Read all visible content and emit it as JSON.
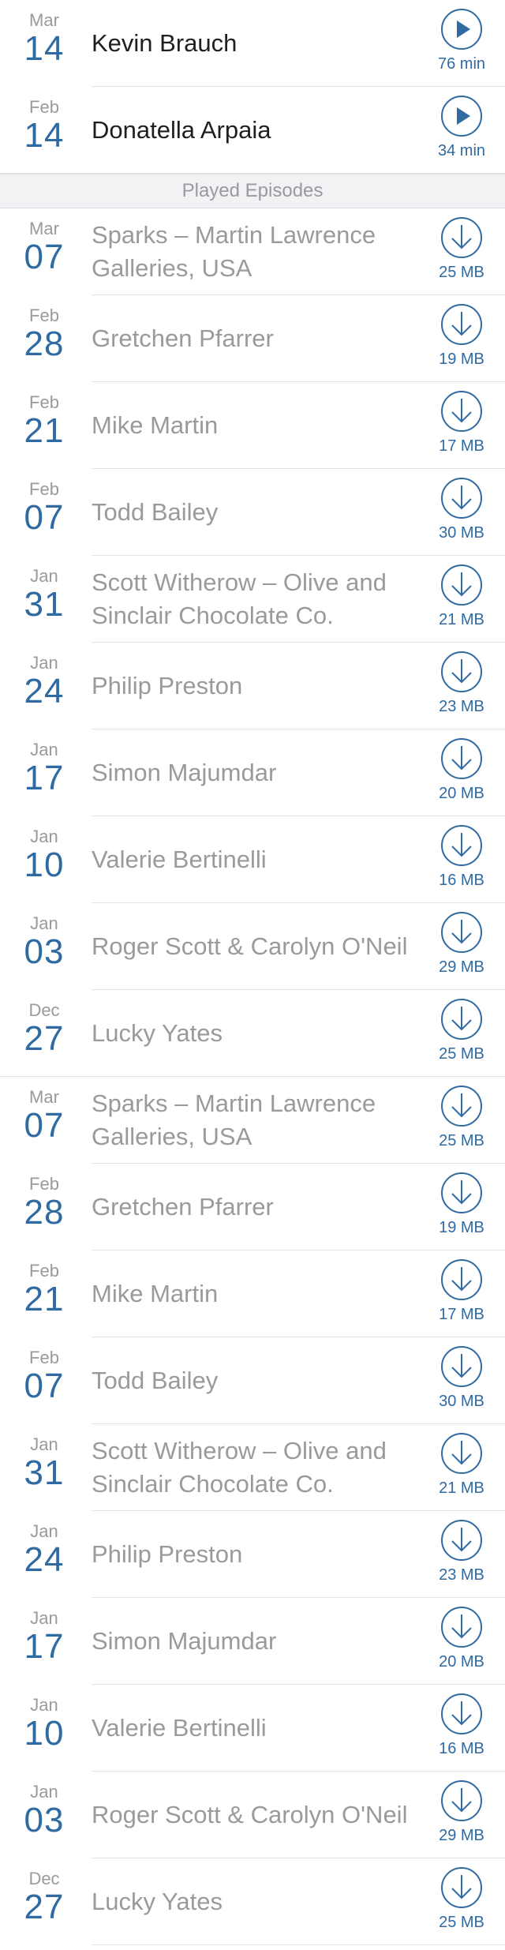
{
  "colors": {
    "accent": "#2f6aa3",
    "muted": "#9a9a9e",
    "separator": "#e3e3e6",
    "header_bg": "#f2f2f4"
  },
  "unplayed": [
    {
      "month": "Mar",
      "day": "14",
      "title": "Kevin Brauch",
      "action": "play-icon",
      "meta": "76 min"
    },
    {
      "month": "Feb",
      "day": "14",
      "title": "Donatella Arpaia",
      "action": "play-icon",
      "meta": "34 min"
    }
  ],
  "played_header": "Played Episodes",
  "played": [
    {
      "month": "Mar",
      "day": "07",
      "title": "Sparks – Martin Lawrence Galleries, USA",
      "action": "download-icon",
      "meta": "25 MB"
    },
    {
      "month": "Feb",
      "day": "28",
      "title": "Gretchen Pfarrer",
      "action": "download-icon",
      "meta": "19 MB"
    },
    {
      "month": "Feb",
      "day": "21",
      "title": "Mike Martin",
      "action": "download-icon",
      "meta": "17 MB"
    },
    {
      "month": "Feb",
      "day": "07",
      "title": "Todd Bailey",
      "action": "download-icon",
      "meta": "30 MB"
    },
    {
      "month": "Jan",
      "day": "31",
      "title": "Scott Witherow – Olive and Sinclair Chocolate Co.",
      "action": "download-icon",
      "meta": "21 MB"
    },
    {
      "month": "Jan",
      "day": "24",
      "title": "Philip Preston",
      "action": "download-icon",
      "meta": "23 MB"
    },
    {
      "month": "Jan",
      "day": "17",
      "title": "Simon Majumdar",
      "action": "download-icon",
      "meta": "20 MB"
    },
    {
      "month": "Jan",
      "day": "10",
      "title": "Valerie Bertinelli",
      "action": "download-icon",
      "meta": "16 MB"
    },
    {
      "month": "Jan",
      "day": "03",
      "title": "Roger Scott & Carolyn O'Neil",
      "action": "download-icon",
      "meta": "29 MB"
    },
    {
      "month": "Dec",
      "day": "27",
      "title": "Lucky Yates",
      "action": "download-icon",
      "meta": "25 MB"
    },
    {
      "month": "Mar",
      "day": "07",
      "title": "Sparks – Martin Lawrence Galleries, USA",
      "action": "download-icon",
      "meta": "25 MB"
    },
    {
      "month": "Feb",
      "day": "28",
      "title": "Gretchen Pfarrer",
      "action": "download-icon",
      "meta": "19 MB"
    },
    {
      "month": "Feb",
      "day": "21",
      "title": "Mike Martin",
      "action": "download-icon",
      "meta": "17 MB"
    },
    {
      "month": "Feb",
      "day": "07",
      "title": "Todd Bailey",
      "action": "download-icon",
      "meta": "30 MB"
    },
    {
      "month": "Jan",
      "day": "31",
      "title": "Scott Witherow – Olive and Sinclair Chocolate Co.",
      "action": "download-icon",
      "meta": "21 MB"
    },
    {
      "month": "Jan",
      "day": "24",
      "title": "Philip Preston",
      "action": "download-icon",
      "meta": "23 MB"
    },
    {
      "month": "Jan",
      "day": "17",
      "title": "Simon Majumdar",
      "action": "download-icon",
      "meta": "20 MB"
    },
    {
      "month": "Jan",
      "day": "10",
      "title": "Valerie Bertinelli",
      "action": "download-icon",
      "meta": "16 MB"
    },
    {
      "month": "Jan",
      "day": "03",
      "title": "Roger Scott & Carolyn O'Neil",
      "action": "download-icon",
      "meta": "29 MB"
    },
    {
      "month": "Dec",
      "day": "27",
      "title": "Lucky Yates",
      "action": "download-icon",
      "meta": "25 MB"
    }
  ]
}
